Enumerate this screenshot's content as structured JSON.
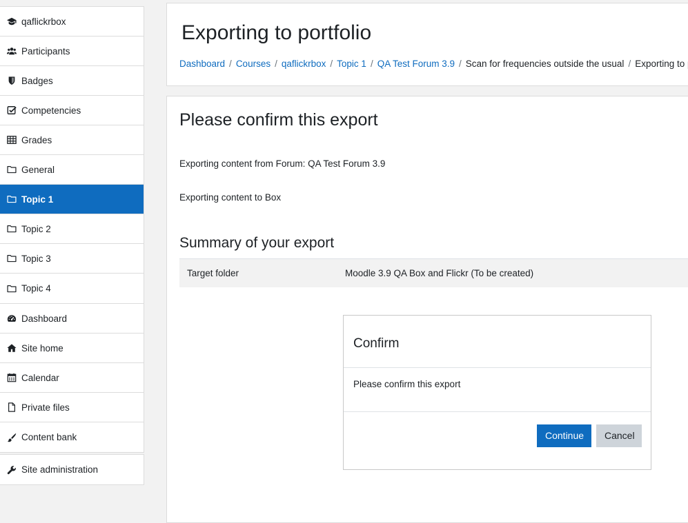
{
  "sidebar": {
    "course_nav": [
      {
        "label": "qaflickrbox",
        "icon": "graduation-cap-icon",
        "active": false
      },
      {
        "label": "Participants",
        "icon": "users-icon",
        "active": false
      },
      {
        "label": "Badges",
        "icon": "shield-icon",
        "active": false
      },
      {
        "label": "Competencies",
        "icon": "check-square-icon",
        "active": false
      },
      {
        "label": "Grades",
        "icon": "table-icon",
        "active": false
      },
      {
        "label": "General",
        "icon": "folder-icon",
        "active": false
      },
      {
        "label": "Topic 1",
        "icon": "folder-icon",
        "active": true
      },
      {
        "label": "Topic 2",
        "icon": "folder-icon",
        "active": false
      },
      {
        "label": "Topic 3",
        "icon": "folder-icon",
        "active": false
      },
      {
        "label": "Topic 4",
        "icon": "folder-icon",
        "active": false
      }
    ],
    "site_nav": [
      {
        "label": "Dashboard",
        "icon": "tachometer-icon"
      },
      {
        "label": "Site home",
        "icon": "home-icon"
      },
      {
        "label": "Calendar",
        "icon": "calendar-icon"
      },
      {
        "label": "Private files",
        "icon": "file-icon"
      },
      {
        "label": "Content bank",
        "icon": "paint-brush-icon"
      }
    ],
    "admin_nav": [
      {
        "label": "Site administration",
        "icon": "wrench-icon"
      }
    ]
  },
  "header": {
    "title": "Exporting to portfolio",
    "breadcrumb": [
      {
        "label": "Dashboard",
        "link": true
      },
      {
        "label": "Courses",
        "link": true
      },
      {
        "label": "qaflickrbox",
        "link": true
      },
      {
        "label": "Topic 1",
        "link": true
      },
      {
        "label": "QA Test Forum 3.9",
        "link": true
      },
      {
        "label": "Scan for frequencies outside the usual",
        "link": false
      },
      {
        "label": "Exporting to portfolio",
        "link": false
      }
    ]
  },
  "content": {
    "heading": "Please confirm this export",
    "exporting_from": "Exporting content from Forum: QA Test Forum 3.9",
    "exporting_to": "Exporting content to Box",
    "summary_heading": "Summary of your export",
    "summary": {
      "label": "Target folder",
      "value": "Moodle 3.9 QA Box and Flickr (To be created)"
    }
  },
  "dialog": {
    "title": "Confirm",
    "message": "Please confirm this export",
    "continue_label": "Continue",
    "cancel_label": "Cancel"
  },
  "colors": {
    "accent": "#0f6cbf",
    "secondary_button": "#ced4da"
  }
}
